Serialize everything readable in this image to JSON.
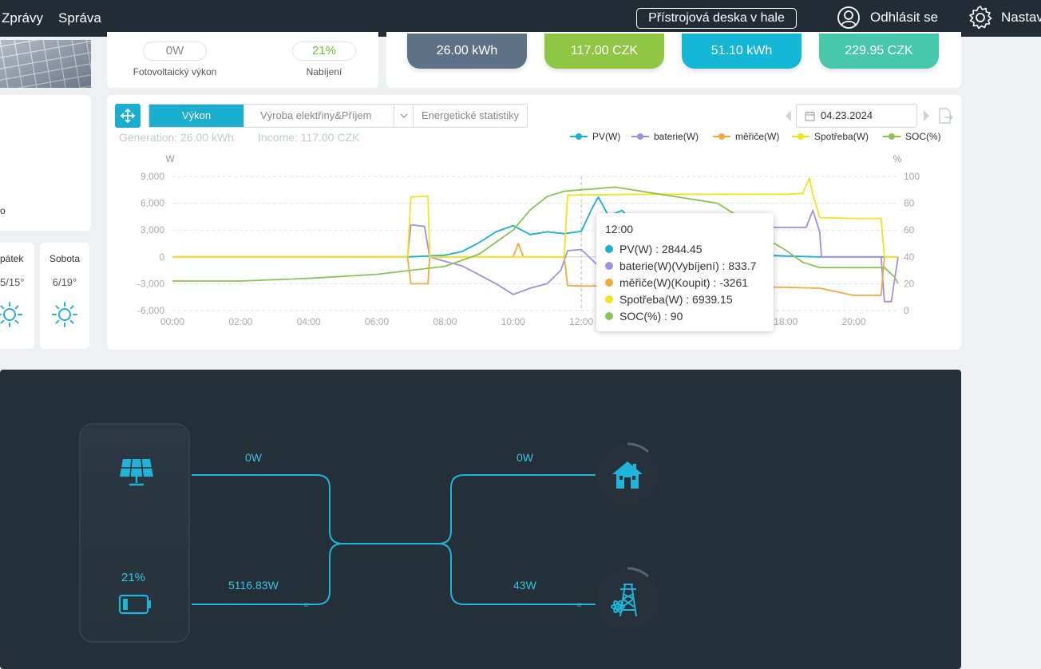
{
  "topbar": {
    "nav": [
      "Zprávy",
      "Správa"
    ],
    "hall_button": "Přístrojová deska v hale",
    "logout": "Odhlásit se",
    "settings": "Nastav"
  },
  "left_panel": {
    "partial_text": "o",
    "weather": [
      {
        "day": "pátek",
        "temp": "5/15°",
        "icon": "sun-icon"
      },
      {
        "day": "Sobota",
        "temp": "6/19°",
        "icon": "sun-icon"
      }
    ]
  },
  "status": {
    "pv_value": "0W",
    "pv_label": "Fotovoltaický výkon",
    "charge_value": "21%",
    "charge_label": "Nabíjení"
  },
  "tiles": [
    {
      "value": "26.00 kWh",
      "color": "#5d7286"
    },
    {
      "value": "117.00 CZK",
      "color": "#8fc744"
    },
    {
      "value": "51.10 kWh",
      "color": "#14b8d6"
    },
    {
      "value": "229.95 CZK",
      "color": "#47c8ad"
    }
  ],
  "chart_panel": {
    "tabs": [
      "Výkon",
      "Výroba elektřiny&Příjem",
      "Energetické statistiky"
    ],
    "generation": "Generation: 26.00 kWh",
    "income": "Income: 117.00 CZK",
    "date": "04.23.2024"
  },
  "tooltip": {
    "time": "12:00",
    "rows": [
      {
        "text": "PV(W) : 2844.45",
        "color": "#1ab0d2"
      },
      {
        "text": "baterie(W)(Vybíjení) : 833.7",
        "color": "#a38ee0"
      },
      {
        "text": "měřiče(W)(Koupit) : -3261",
        "color": "#f5a93c"
      },
      {
        "text": "Spotřeba(W) : 6939.15",
        "color": "#f5e31a"
      },
      {
        "text": "SOC(%) : 90",
        "color": "#8cc453"
      }
    ]
  },
  "chart_data": {
    "type": "line",
    "title": "",
    "ylabel": "W",
    "y2label": "%",
    "ylim": [
      -6000,
      9000
    ],
    "y2lim": [
      0,
      100
    ],
    "yticks": [
      "9,000",
      "6,000",
      "3,000",
      "0",
      "-3,000",
      "-6,000"
    ],
    "y2ticks": [
      "100",
      "80",
      "60",
      "40",
      "20",
      "0"
    ],
    "xticks": [
      "00:00",
      "02:00",
      "04:00",
      "06:00",
      "08:00",
      "10:00",
      "12:00",
      "14:00",
      "16:00",
      "18:00",
      "20:00"
    ],
    "legend_position": "top-right",
    "series": [
      {
        "name": "PV(W)",
        "color": "#1ab0d2",
        "axis": "left",
        "points": [
          [
            0,
            0
          ],
          [
            6.9,
            0
          ],
          [
            7.5,
            100
          ],
          [
            8,
            200
          ],
          [
            8.5,
            600
          ],
          [
            9,
            1600
          ],
          [
            9.5,
            2800
          ],
          [
            10,
            3500
          ],
          [
            10.5,
            2500
          ],
          [
            11,
            2800
          ],
          [
            11.5,
            2600
          ],
          [
            12,
            2844
          ],
          [
            12.3,
            5300
          ],
          [
            12.5,
            6700
          ],
          [
            12.8,
            4600
          ],
          [
            13.2,
            5200
          ],
          [
            13.6,
            3600
          ],
          [
            14,
            2500
          ],
          [
            15,
            1400
          ],
          [
            16,
            800
          ],
          [
            17,
            300
          ],
          [
            18,
            100
          ],
          [
            19,
            0
          ],
          [
            21,
            0
          ]
        ]
      },
      {
        "name": "baterie(W)",
        "color": "#a38ee0",
        "axis": "left",
        "points": [
          [
            0,
            0
          ],
          [
            6.9,
            0
          ],
          [
            7,
            3600
          ],
          [
            7.2,
            3500
          ],
          [
            7.4,
            3400
          ],
          [
            7.55,
            0
          ],
          [
            8,
            -500
          ],
          [
            8.5,
            -1000
          ],
          [
            9,
            -2000
          ],
          [
            9.5,
            -3000
          ],
          [
            10,
            -4200
          ],
          [
            10.5,
            -3500
          ],
          [
            11,
            -3000
          ],
          [
            11.4,
            -1500
          ],
          [
            11.6,
            700
          ],
          [
            12,
            834
          ],
          [
            12.5,
            -1000
          ],
          [
            13,
            -2000
          ],
          [
            13.5,
            -1500
          ],
          [
            14,
            -200
          ],
          [
            14.5,
            1500
          ],
          [
            15,
            2500
          ],
          [
            16,
            3100
          ],
          [
            17,
            3300
          ],
          [
            18,
            3300
          ],
          [
            18.6,
            3300
          ],
          [
            18.8,
            5200
          ],
          [
            19,
            2800
          ],
          [
            19.05,
            0
          ],
          [
            20,
            0
          ],
          [
            20.8,
            0
          ],
          [
            20.9,
            -5000
          ],
          [
            21.1,
            -5000
          ],
          [
            21.2,
            -2500
          ],
          [
            21.3,
            0
          ]
        ]
      },
      {
        "name": "měřiče(W)",
        "color": "#f5a93c",
        "axis": "left",
        "points": [
          [
            0,
            0
          ],
          [
            6.9,
            0
          ],
          [
            7,
            -3000
          ],
          [
            7.5,
            -3000
          ],
          [
            7.55,
            0
          ],
          [
            10,
            0
          ],
          [
            10.15,
            1500
          ],
          [
            10.3,
            0
          ],
          [
            11.5,
            0
          ],
          [
            11.6,
            -3200
          ],
          [
            12,
            -3261
          ],
          [
            14,
            -3200
          ],
          [
            16,
            -3300
          ],
          [
            18,
            -3400
          ],
          [
            19,
            -3500
          ],
          [
            20,
            -4300
          ],
          [
            20.8,
            -4300
          ],
          [
            20.9,
            0
          ],
          [
            21.3,
            0
          ]
        ]
      },
      {
        "name": "Spotřeba(W)",
        "color": "#f5e31a",
        "axis": "left",
        "points": [
          [
            0,
            0
          ],
          [
            6.9,
            0
          ],
          [
            7,
            6700
          ],
          [
            7.5,
            6800
          ],
          [
            7.55,
            0
          ],
          [
            11.5,
            0
          ],
          [
            11.6,
            6900
          ],
          [
            12,
            6939
          ],
          [
            14,
            7000
          ],
          [
            16,
            7000
          ],
          [
            18,
            7000
          ],
          [
            18.5,
            7100
          ],
          [
            18.7,
            8800
          ],
          [
            18.8,
            7000
          ],
          [
            19,
            4400
          ],
          [
            20,
            4300
          ],
          [
            20.8,
            4300
          ],
          [
            20.9,
            0
          ],
          [
            21.3,
            0
          ]
        ]
      },
      {
        "name": "SOC(%)",
        "color": "#8cc453",
        "axis": "right",
        "points": [
          [
            0,
            22
          ],
          [
            2,
            22
          ],
          [
            4,
            24
          ],
          [
            6,
            27
          ],
          [
            7,
            30
          ],
          [
            8,
            33
          ],
          [
            9,
            42
          ],
          [
            10,
            60
          ],
          [
            10.5,
            75
          ],
          [
            11,
            85
          ],
          [
            11.5,
            89
          ],
          [
            12,
            90
          ],
          [
            13,
            92
          ],
          [
            14,
            88
          ],
          [
            15,
            84
          ],
          [
            16,
            80
          ],
          [
            16.5,
            72
          ],
          [
            17,
            60
          ],
          [
            18,
            45
          ],
          [
            18.5,
            36
          ],
          [
            19,
            32
          ],
          [
            20,
            32
          ],
          [
            20.9,
            32
          ],
          [
            21.2,
            25
          ],
          [
            21.3,
            20
          ]
        ]
      }
    ]
  },
  "flow": {
    "pv_value": "0W",
    "battery_value": "5116.83W",
    "home_value": "0W",
    "grid_value": "43W",
    "battery_soc": "21%"
  }
}
